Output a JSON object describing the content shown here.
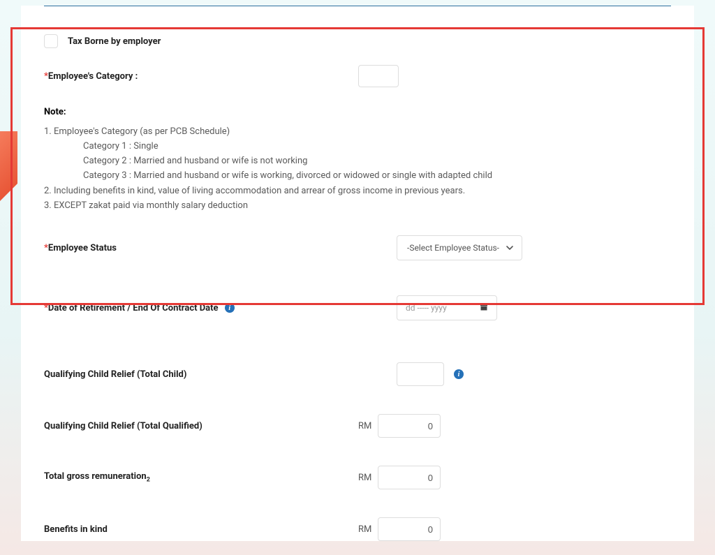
{
  "checkbox_tax_borne": "Tax Borne by employer",
  "employee_category_label": "Employee's Category :",
  "note_title": "Note:",
  "note_1": "1. Employee's Category (as per PCB Schedule)",
  "note_1a": "Category 1 : Single",
  "note_1b": "Category 2 : Married and husband or wife is not working",
  "note_1c": "Category 3 : Married and husband or wife is working, divorced or widowed or single with adapted child",
  "note_2": "2. Including benefits in kind, value of living accommodation and arrear of gross income in previous years.",
  "note_3": "3. EXCEPT zakat paid via monthly salary deduction",
  "employee_status_label": "Employee Status",
  "employee_status_placeholder": "-Select Employee Status-",
  "retirement_label": "Date of Retirement / End Of Contract Date",
  "date_placeholder": "dd -----  yyyy",
  "child_relief_total_label": "Qualifying Child Relief (Total Child)",
  "child_relief_qualified_label": "Qualifying Child Relief (Total Qualified)",
  "gross_remuneration_label": "Total gross remuneration",
  "gross_subscript": "2",
  "benefits_label": "Benefits in kind",
  "currency": "RM",
  "zero": "0",
  "info_glyph": "i"
}
